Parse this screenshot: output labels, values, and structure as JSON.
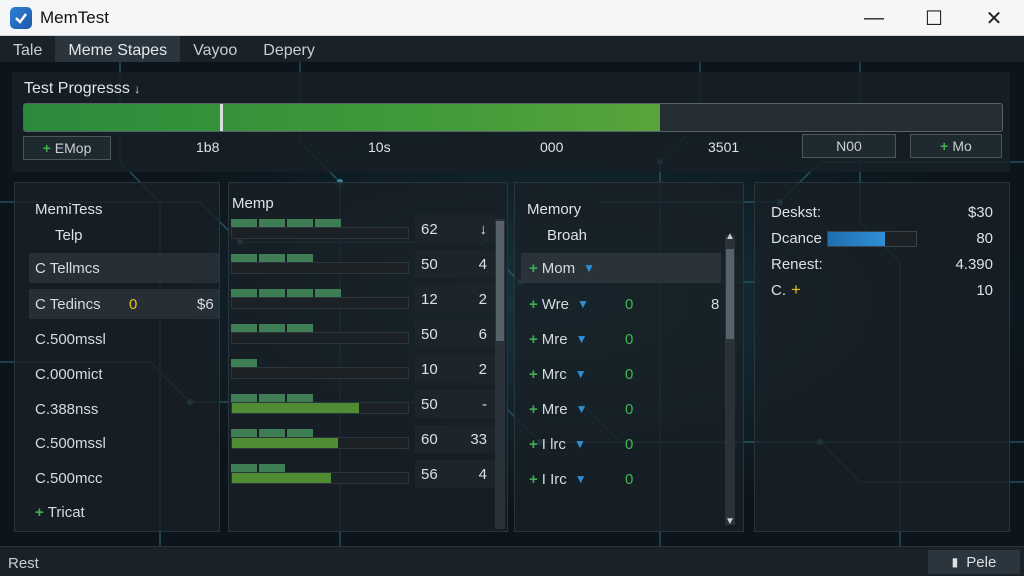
{
  "window": {
    "title": "MemTest",
    "minimize": "—",
    "maximize": "☐",
    "close": "✕"
  },
  "menu": [
    "Tale",
    "Meme Stapes",
    "Vayoo",
    "Depery"
  ],
  "progress": {
    "title": "Test Progresss",
    "title_suffix": "↓",
    "fraction": 0.65,
    "marker_fraction": 0.2,
    "left_button": "EMop",
    "right_button_1": "N00",
    "right_button_2": "Mo",
    "ticks": [
      "1b8",
      "10s",
      "000",
      "3501"
    ]
  },
  "panel1": {
    "header_1": "MemiTess",
    "header_2": "Telp",
    "rows": [
      {
        "label": "C Tellmcs",
        "value1": "",
        "value2": ""
      },
      {
        "label": "C Tedincs",
        "value1": "0",
        "value2": "$6"
      },
      {
        "label": "C.500mssl",
        "value1": "",
        "value2": ""
      },
      {
        "label": "C.000mict",
        "value1": "",
        "value2": ""
      },
      {
        "label": "C.388nss",
        "value1": "",
        "value2": ""
      },
      {
        "label": "C.500mssl",
        "value1": "",
        "value2": ""
      },
      {
        "label": "C.500mcc",
        "value1": "",
        "value2": ""
      }
    ],
    "add_label": "Tricat"
  },
  "panel2": {
    "header": "Memp",
    "rows": [
      {
        "segments": 4,
        "fill": 0.0,
        "v1": "62",
        "v2": "↓"
      },
      {
        "segments": 3,
        "fill": 0.0,
        "v1": "50",
        "v2": "4"
      },
      {
        "segments": 4,
        "fill": 0.0,
        "v1": "12",
        "v2": "2"
      },
      {
        "segments": 3,
        "fill": 0.0,
        "v1": "50",
        "v2": "6"
      },
      {
        "segments": 1,
        "fill": 0.0,
        "v1": "10",
        "v2": "2"
      },
      {
        "segments": 3,
        "fill": 0.72,
        "v1": "50",
        "v2": "-"
      },
      {
        "segments": 3,
        "fill": 0.6,
        "v1": "60",
        "v2": "33"
      },
      {
        "segments": 2,
        "fill": 0.56,
        "v1": "56",
        "v2": "4"
      }
    ]
  },
  "panel3": {
    "header_1": "Memory",
    "header_2": "Broah",
    "rows": [
      {
        "label": "Mom",
        "green": "",
        "value": ""
      },
      {
        "label": "Wre",
        "green": "0",
        "value": "8"
      },
      {
        "label": "Mre",
        "green": "0",
        "value": ""
      },
      {
        "label": "Mrc",
        "green": "0",
        "value": ""
      },
      {
        "label": "Mre",
        "green": "0",
        "value": ""
      },
      {
        "label": "I lrc",
        "green": "0",
        "value": ""
      },
      {
        "label": "I Irc",
        "green": "0",
        "value": ""
      }
    ]
  },
  "panel4": {
    "stats": [
      {
        "label": "Deskst:",
        "value": "$30"
      },
      {
        "label": "Dcance",
        "value": "80",
        "bar_fraction": 0.65
      },
      {
        "label": "Renest:",
        "value": "4.390"
      },
      {
        "label": "C.",
        "value": "10"
      }
    ]
  },
  "status": {
    "text": "Rest",
    "button": "Pele"
  },
  "colors": {
    "accent_green": "#3e9a3a",
    "accent_blue": "#2f8fd6",
    "warning_yellow": "#e8c21c"
  }
}
